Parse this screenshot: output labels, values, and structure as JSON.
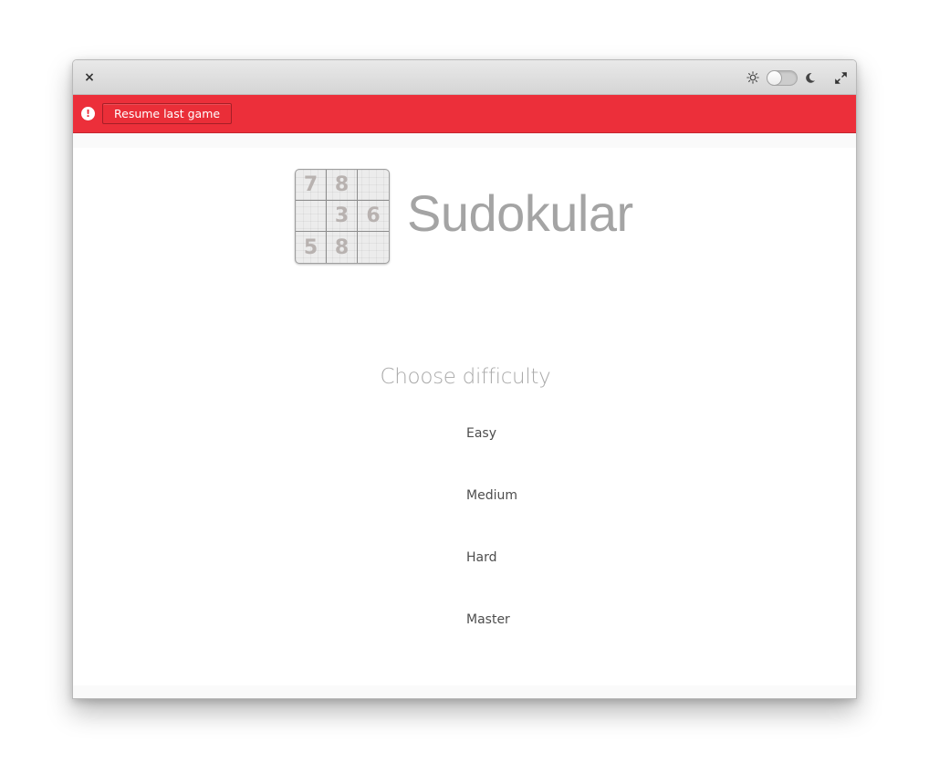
{
  "window": {
    "close_label": "×"
  },
  "infobar": {
    "icon": "exclamation-icon",
    "icon_glyph": "!",
    "resume_label": "Resume last game",
    "color": "#ec2f3a"
  },
  "header": {
    "light_icon": "sun-icon",
    "dark_icon": "moon-icon",
    "dark_mode": false,
    "maximize_icon": "maximize-icon"
  },
  "logo": {
    "cells": [
      "7",
      "8",
      "",
      "",
      "3",
      "6",
      "5",
      "8",
      ""
    ]
  },
  "app_title": "Sudokular",
  "difficulty": {
    "heading": "Choose difficulty",
    "options": [
      "Easy",
      "Medium",
      "Hard",
      "Master"
    ]
  }
}
